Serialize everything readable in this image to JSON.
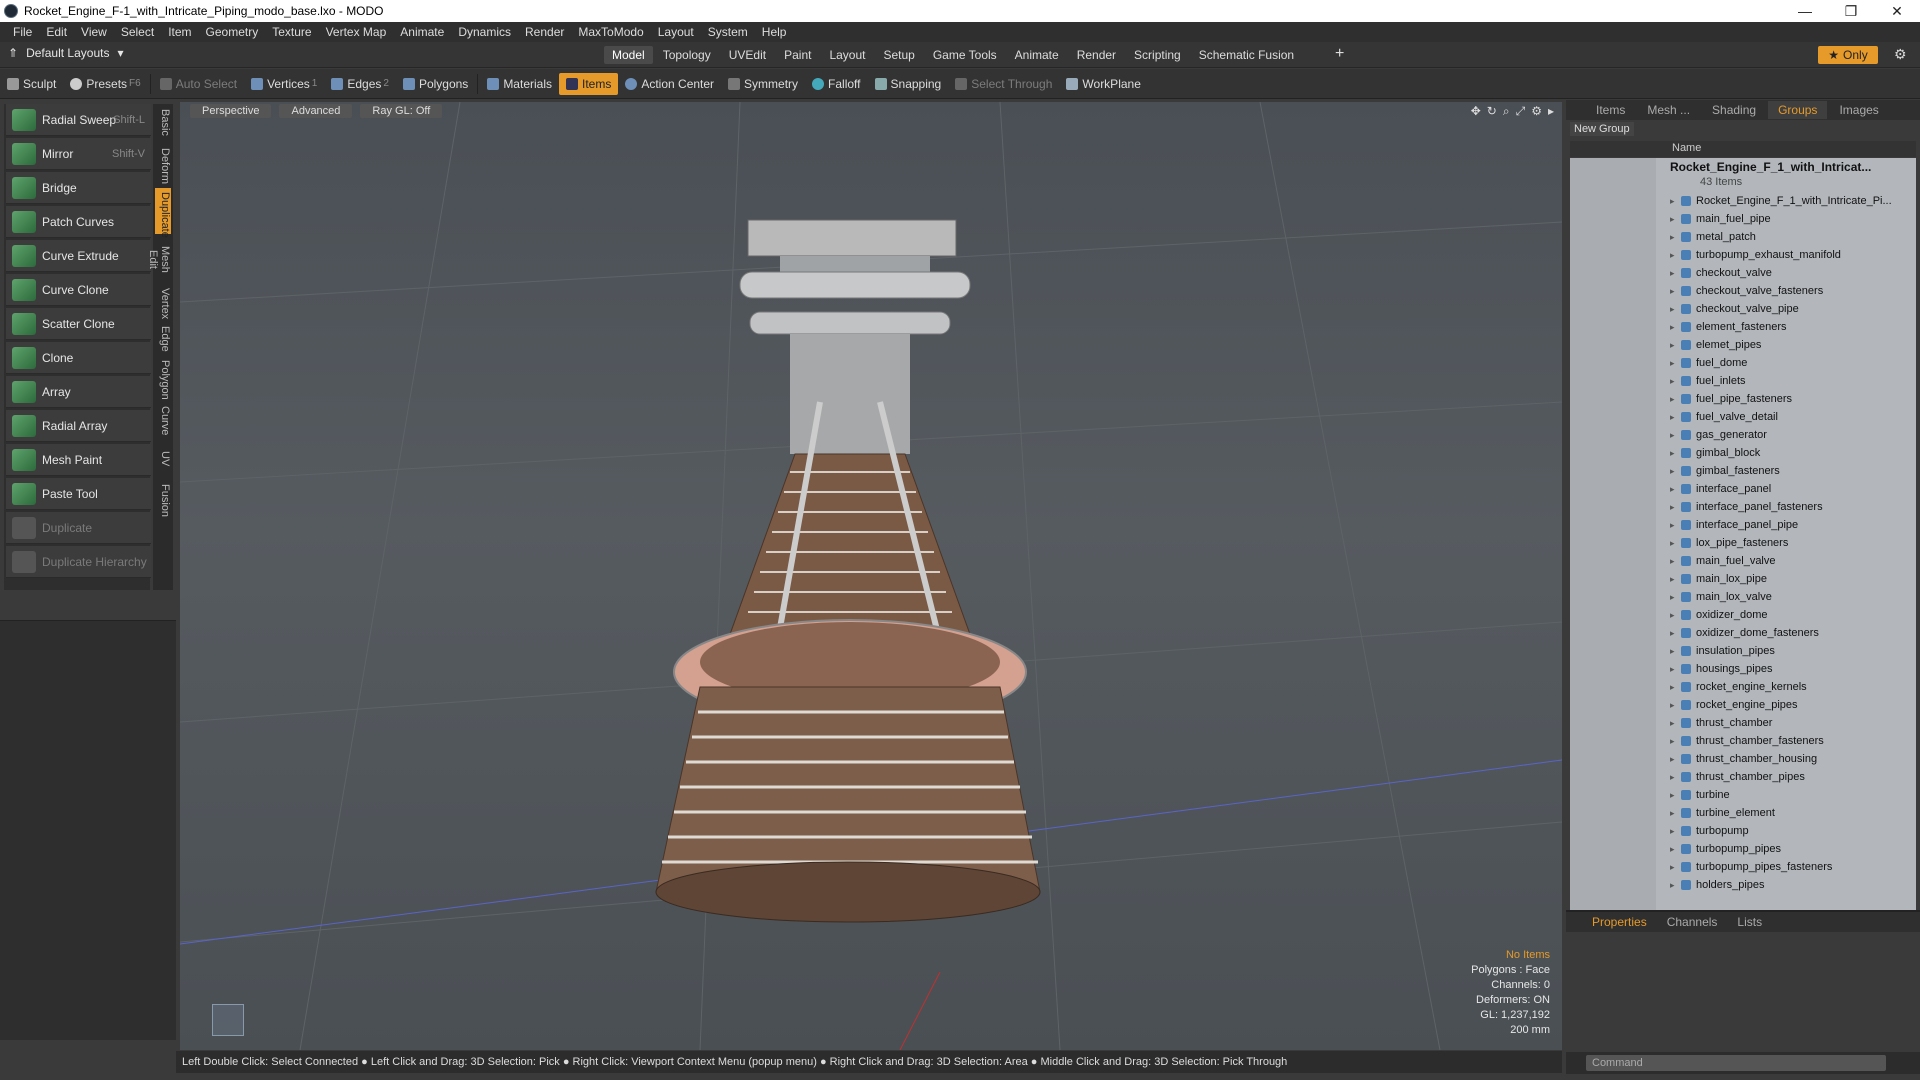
{
  "window": {
    "title": "Rocket_Engine_F-1_with_Intricate_Piping_modo_base.lxo - MODO"
  },
  "menu": [
    "File",
    "Edit",
    "View",
    "Select",
    "Item",
    "Geometry",
    "Texture",
    "Vertex Map",
    "Animate",
    "Dynamics",
    "Render",
    "MaxToModo",
    "Layout",
    "System",
    "Help"
  ],
  "layouts": {
    "label": "Default Layouts"
  },
  "mode_tabs": [
    "Model",
    "Topology",
    "UVEdit",
    "Paint",
    "Layout",
    "Setup",
    "Game Tools",
    "Animate",
    "Render",
    "Scripting",
    "Schematic Fusion"
  ],
  "only_label": "Only",
  "toolbar": {
    "sculpt": "Sculpt",
    "presets": "Presets",
    "presets_key": "F6",
    "auto_select": "Auto Select",
    "vertices": "Vertices",
    "vertices_n": "1",
    "edges": "Edges",
    "edges_n": "2",
    "polygons": "Polygons",
    "materials": "Materials",
    "items": "Items",
    "action_center": "Action Center",
    "symmetry": "Symmetry",
    "falloff": "Falloff",
    "snapping": "Snapping",
    "select_through": "Select Through",
    "workplane": "WorkPlane"
  },
  "tools": [
    {
      "label": "Radial Sweep",
      "key": "Shift-L"
    },
    {
      "label": "Mirror",
      "key": "Shift-V"
    },
    {
      "label": "Bridge",
      "key": ""
    },
    {
      "label": "Patch Curves",
      "key": ""
    },
    {
      "label": "Curve Extrude",
      "key": ""
    },
    {
      "label": "Curve Clone",
      "key": ""
    },
    {
      "label": "Scatter Clone",
      "key": ""
    },
    {
      "label": "Clone",
      "key": ""
    },
    {
      "label": "Array",
      "key": ""
    },
    {
      "label": "Radial Array",
      "key": ""
    },
    {
      "label": "Mesh Paint",
      "key": ""
    },
    {
      "label": "Paste Tool",
      "key": ""
    },
    {
      "label": "Duplicate",
      "key": ""
    },
    {
      "label": "Duplicate Hierarchy",
      "key": ""
    }
  ],
  "vtabs": [
    "Basic",
    "Deform",
    "Duplicate",
    "Mesh Edit",
    "Vertex",
    "Edge",
    "Polygon",
    "Curve",
    "UV",
    "Fusion"
  ],
  "viewport": {
    "view": "Perspective",
    "shading": "Advanced",
    "raygl": "Ray GL: Off",
    "info": {
      "selection": "No Items",
      "polygons": "Polygons : Face",
      "channels": "Channels: 0",
      "deformers": "Deformers: ON",
      "gl": "GL: 1,237,192",
      "scale": "200 mm"
    }
  },
  "status": "Left Double Click: Select Connected ● Left Click and Drag: 3D Selection: Pick ● Right Click: Viewport Context Menu (popup menu) ● Right Click and Drag: 3D Selection: Area ● Middle Click and Drag: 3D Selection: Pick Through",
  "panel": {
    "tabs": [
      "Items",
      "Mesh ...",
      "Shading",
      "Groups",
      "Images"
    ],
    "new_group": "New Group",
    "name_col": "Name",
    "root": "Rocket_Engine_F_1_with_Intricat...",
    "count": "43 Items",
    "items": [
      "Rocket_Engine_F_1_with_Intricate_Pi...",
      "main_fuel_pipe",
      "metal_patch",
      "turbopump_exhaust_manifold",
      "checkout_valve",
      "checkout_valve_fasteners",
      "checkout_valve_pipe",
      "element_fasteners",
      "elemet_pipes",
      "fuel_dome",
      "fuel_inlets",
      "fuel_pipe_fasteners",
      "fuel_valve_detail",
      "gas_generator",
      "gimbal_block",
      "gimbal_fasteners",
      "interface_panel",
      "interface_panel_fasteners",
      "interface_panel_pipe",
      "lox_pipe_fasteners",
      "main_fuel_valve",
      "main_lox_pipe",
      "main_lox_valve",
      "oxidizer_dome",
      "oxidizer_dome_fasteners",
      "insulation_pipes",
      "housings_pipes",
      "rocket_engine_kernels",
      "rocket_engine_pipes",
      "thrust_chamber",
      "thrust_chamber_fasteners",
      "thrust_chamber_housing",
      "thrust_chamber_pipes",
      "turbine",
      "turbine_element",
      "turbopump",
      "turbopump_pipes",
      "turbopump_pipes_fasteners",
      "holders_pipes"
    ]
  },
  "props_tabs": [
    "Properties",
    "Channels",
    "Lists"
  ],
  "command_placeholder": "Command",
  "colors": {
    "accent": "#e59a2a",
    "list_bg": "#b3b7bc"
  }
}
